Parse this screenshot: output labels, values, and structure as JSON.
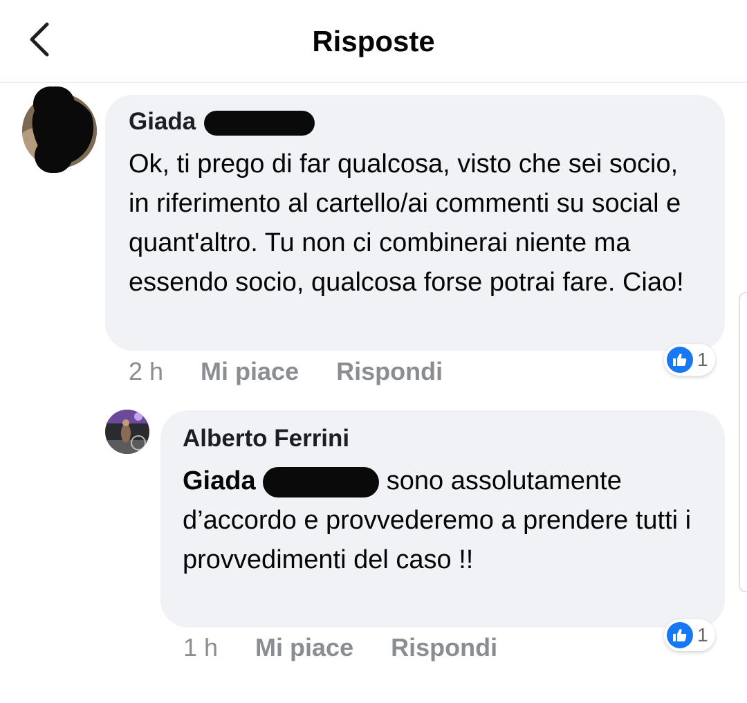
{
  "header": {
    "title": "Risposte",
    "back_icon": "chevron-left-icon"
  },
  "comments": [
    {
      "author": "Giada",
      "text": "Ok, ti prego di far qualcosa, visto che sei socio, in riferimento al cartello/ai commenti su social e quant'altro. Tu non ci combinerai niente ma essendo socio, qualcosa forse potrai fare. Ciao!",
      "time": "2 h",
      "like_label": "Mi piace",
      "reply_label": "Rispondi",
      "reaction_count": "1"
    },
    {
      "author": "Alberto Ferrini",
      "mention": "Giada",
      "text": "sono assolutamente d’accordo e provvederemo a prendere tutti i provvedimenti del caso !!",
      "time": "1 h",
      "like_label": "Mi piace",
      "reply_label": "Rispondi",
      "reaction_count": "1"
    }
  ],
  "colors": {
    "bubble": "#f0f2f5",
    "meta": "#8a8d91",
    "like": "#1877f2"
  }
}
